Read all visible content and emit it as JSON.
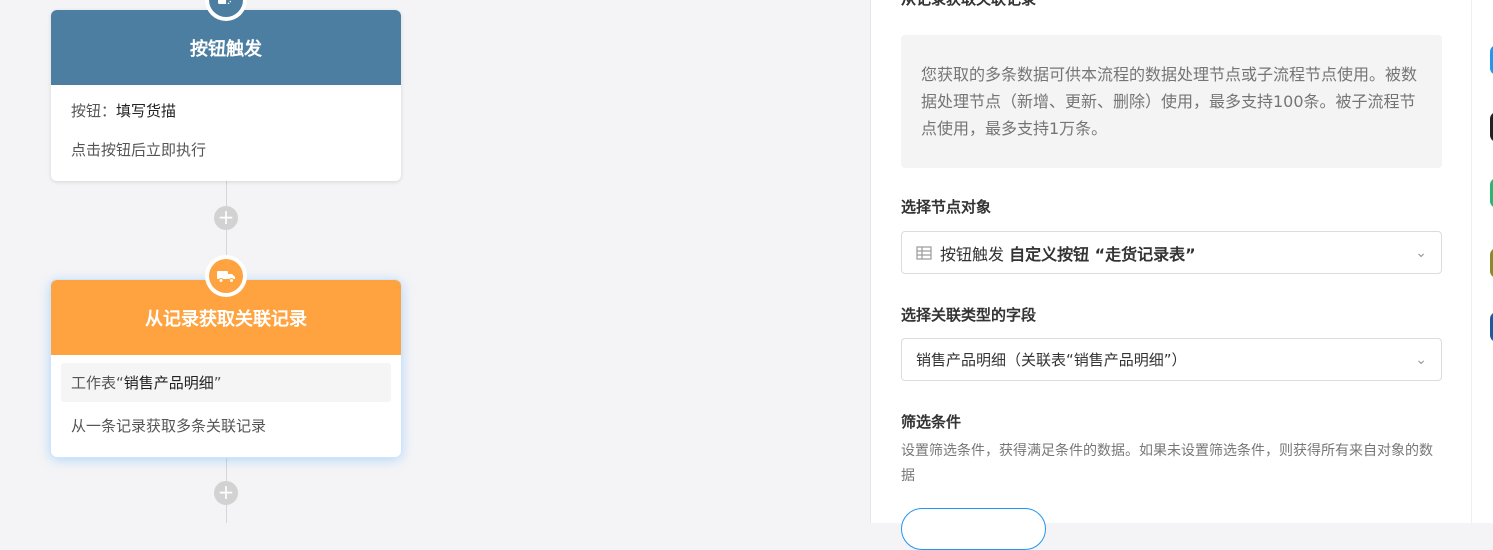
{
  "flow": {
    "trigger_node": {
      "title": "按钮触发",
      "icon": "button-trigger-icon",
      "color": "#4b7ea1",
      "button_label": "按钮：",
      "button_value": "填写货描",
      "exec_text": "点击按钮后立即执行"
    },
    "fetch_node": {
      "title": "从记录获取关联记录",
      "icon": "truck-icon",
      "color": "#ffa340",
      "worksheet_prefix": "工作表“",
      "worksheet_name": "销售产品明细",
      "worksheet_suffix": "”",
      "description": "从一条记录获取多条关联记录"
    },
    "add_step_symbol": "+"
  },
  "panel": {
    "top_title": "从记录获取关联记录",
    "info": "您获取的多条数据可供本流程的数据处理节点或子流程节点使用。被数据处理节点（新增、更新、删除）使用，最多支持100条。被子流程节点使用，最多支持1万条。",
    "node_object": {
      "label": "选择节点对象",
      "value_plain": "按钮触发 ",
      "value_bold": "自定义按钮 “走货记录表”",
      "icon": "table-icon"
    },
    "relation_field": {
      "label": "选择关联类型的字段",
      "value": "销售产品明细（关联表“销售产品明细”）"
    },
    "filter": {
      "label": "筛选条件",
      "description": "设置筛选条件，获得满足条件的数据。如果未设置筛选条件，则获得所有来自对象的数据"
    },
    "chevron": "⌄"
  },
  "rail": {
    "colors": [
      "#2196f3",
      "#222222",
      "#2bb673",
      "#8a8a2a",
      "#1e5aa0"
    ]
  }
}
